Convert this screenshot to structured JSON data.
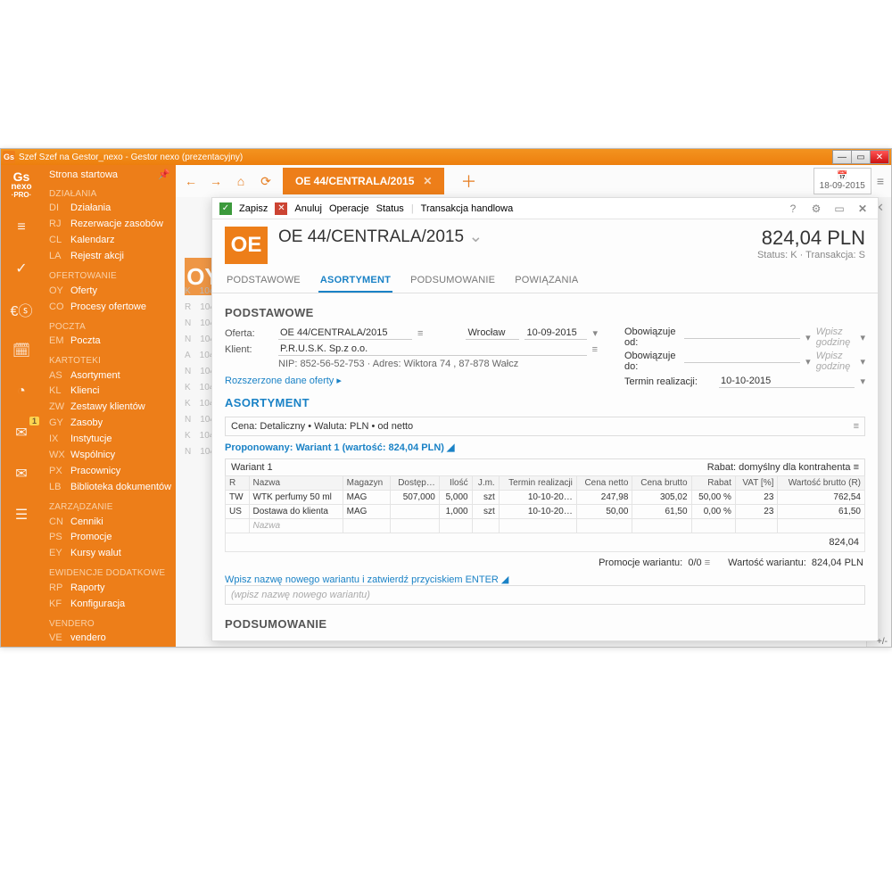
{
  "window_title": "Szef Szef na Gestor_nexo - Gestor nexo (prezentacyjny)",
  "logo": {
    "l1": "Gs",
    "l2": "nexo",
    "l3": "·PRO·"
  },
  "date_top": "18-09-2015",
  "sidebar": {
    "top": "Strona startowa",
    "groups": [
      {
        "header": "DZIAŁANIA",
        "items": [
          [
            "DI",
            "Działania"
          ],
          [
            "RJ",
            "Rezerwacje zasobów"
          ],
          [
            "CL",
            "Kalendarz"
          ],
          [
            "LA",
            "Rejestr akcji"
          ]
        ]
      },
      {
        "header": "OFERTOWANIE",
        "items": [
          [
            "OY",
            "Oferty"
          ],
          [
            "CO",
            "Procesy ofertowe"
          ]
        ]
      },
      {
        "header": "POCZTA",
        "items": [
          [
            "EM",
            "Poczta"
          ]
        ]
      },
      {
        "header": "KARTOTEKI",
        "items": [
          [
            "AS",
            "Asortyment"
          ],
          [
            "KL",
            "Klienci"
          ],
          [
            "ZW",
            "Zestawy klientów"
          ],
          [
            "GY",
            "Zasoby"
          ],
          [
            "IX",
            "Instytucje"
          ],
          [
            "WX",
            "Wspólnicy"
          ],
          [
            "PX",
            "Pracownicy"
          ],
          [
            "LB",
            "Biblioteka dokumentów"
          ]
        ]
      },
      {
        "header": "ZARZĄDZANIE",
        "items": [
          [
            "CN",
            "Cenniki"
          ],
          [
            "PS",
            "Promocje"
          ],
          [
            "EY",
            "Kursy walut"
          ]
        ]
      },
      {
        "header": "EWIDENCJE DODATKOWE",
        "items": [
          [
            "RP",
            "Raporty"
          ],
          [
            "KF",
            "Konfiguracja"
          ]
        ]
      },
      {
        "header": "VENDERO",
        "items": [
          [
            "VE",
            "vendero"
          ]
        ]
      }
    ]
  },
  "tab_title": "OE 44/CENTRALA/2015",
  "toolbar": {
    "save": "Zapisz",
    "cancel": "Anuluj",
    "ops": "Operacje",
    "status": "Status",
    "trans": "Transakcja handlowa"
  },
  "doc": {
    "prefix": "OE",
    "title": "OE 44/CENTRALA/2015",
    "amount": "824,04 PLN",
    "status_line": "Status: K  ·  Transakcja: S"
  },
  "tabs": [
    "PODSTAWOWE",
    "ASORTYMENT",
    "PODSUMOWANIE",
    "POWIĄZANIA"
  ],
  "sect_basic": "PODSTAWOWE",
  "basic": {
    "offer_lbl": "Oferta:",
    "offer_val": "OE 44/CENTRALA/2015",
    "city": "Wrocław",
    "offer_date": "10-09-2015",
    "client_lbl": "Klient:",
    "client_val": "P.R.U.S.K. Sp.z o.o.",
    "nip_line": "NIP:  852-56-52-753  ·  Adres:  Wiktora 74 , 87-878 Wałcz",
    "from_lbl": "Obowiązuje od:",
    "to_lbl": "Obowiązuje do:",
    "deadline_lbl": "Termin realizacji:",
    "deadline_val": "10-10-2015",
    "hour_ph": "Wpisz godzinę",
    "ext_link": "Rozszerzone dane oferty ▸"
  },
  "sect_asort": "ASORTYMENT",
  "price_line": "Cena: Detaliczny • Waluta: PLN • od netto",
  "proposed": "Proponowany: Wariant 1 (wartość: 824,04 PLN) ◢",
  "variant": "Wariant 1",
  "rabat_line": "Rabat: domyślny dla kontrahenta ≡",
  "table": {
    "headers": [
      "R",
      "Nazwa",
      "Magazyn",
      "Dostęp…",
      "Ilość",
      "J.m.",
      "Termin realizacji",
      "Cena netto",
      "Cena brutto",
      "Rabat",
      "VAT [%]",
      "Wartość brutto (R)"
    ],
    "rows": [
      [
        "TW",
        "WTK perfumy 50 ml",
        "MAG",
        "507,000",
        "5,000",
        "szt",
        "10-10-20…",
        "247,98",
        "305,02",
        "50,00 %",
        "23",
        "762,54"
      ],
      [
        "US",
        "Dostawa do klienta",
        "MAG",
        "",
        "1,000",
        "szt",
        "10-10-20…",
        "50,00",
        "61,50",
        "0,00 %",
        "23",
        "61,50"
      ]
    ],
    "placeholder": "Nazwa",
    "total": "824,04"
  },
  "promo": {
    "lbl": "Promocje wariantu:",
    "val": "0/0",
    "wart_lbl": "Wartość wariantu:",
    "wart_val": "824,04 PLN"
  },
  "new_variant_hint": "Wpisz nazwę nowego wariantu i zatwierdź przyciskiem ENTER ◢",
  "new_variant_ph": "(wpisz nazwę nowego wariantu)",
  "sect_sum": "PODSUMOWANIE"
}
